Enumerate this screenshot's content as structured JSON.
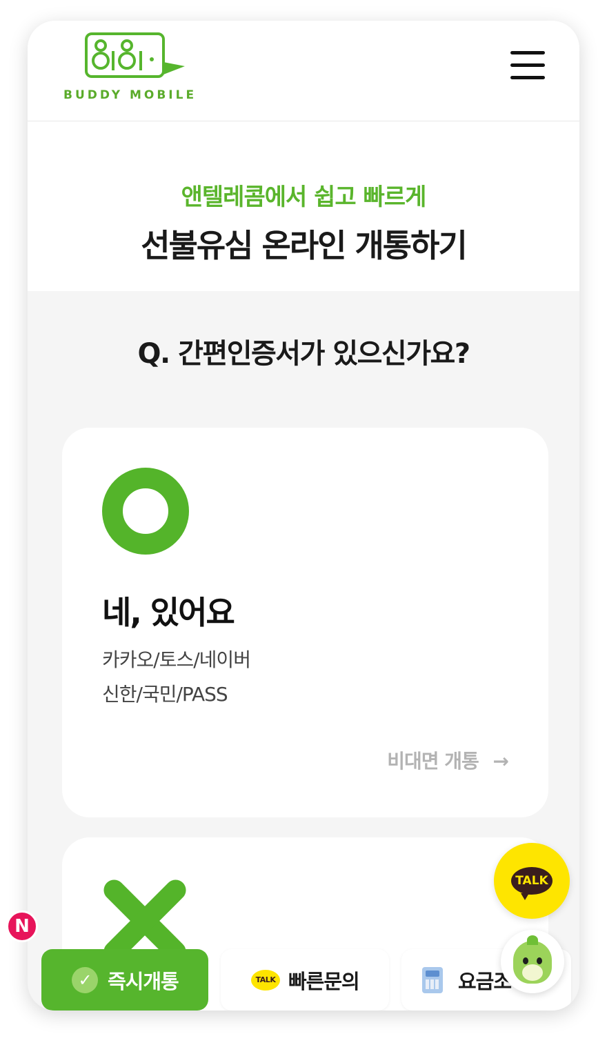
{
  "header": {
    "logo_text": "BUDDY MOBILE",
    "menu_icon": "hamburger-menu-icon"
  },
  "hero": {
    "subtitle": "앤텔레콤에서 쉽고 빠르게",
    "title": "선불유심 온라인 개통하기"
  },
  "question": "Q. 간편인증서가 있으신가요?",
  "card_yes": {
    "icon": "circle-o-icon",
    "title": "네, 있어요",
    "desc_line1": "카카오/토스/네이버",
    "desc_line2": "신한/국민/PASS",
    "link_label": "비대면 개통",
    "arrow": "→"
  },
  "card_no": {
    "icon": "x-mark-icon"
  },
  "bottom_bar": {
    "instant_label": "즉시개통",
    "inquiry_label": "빠른문의",
    "inquiry_icon_text": "TALK",
    "fee_label": "요금조"
  },
  "badge": "N",
  "talk_fab_label": "TALK",
  "colors": {
    "brand_green": "#56b52d",
    "kakao_yellow": "#fee500",
    "badge_pink": "#e7145a"
  }
}
